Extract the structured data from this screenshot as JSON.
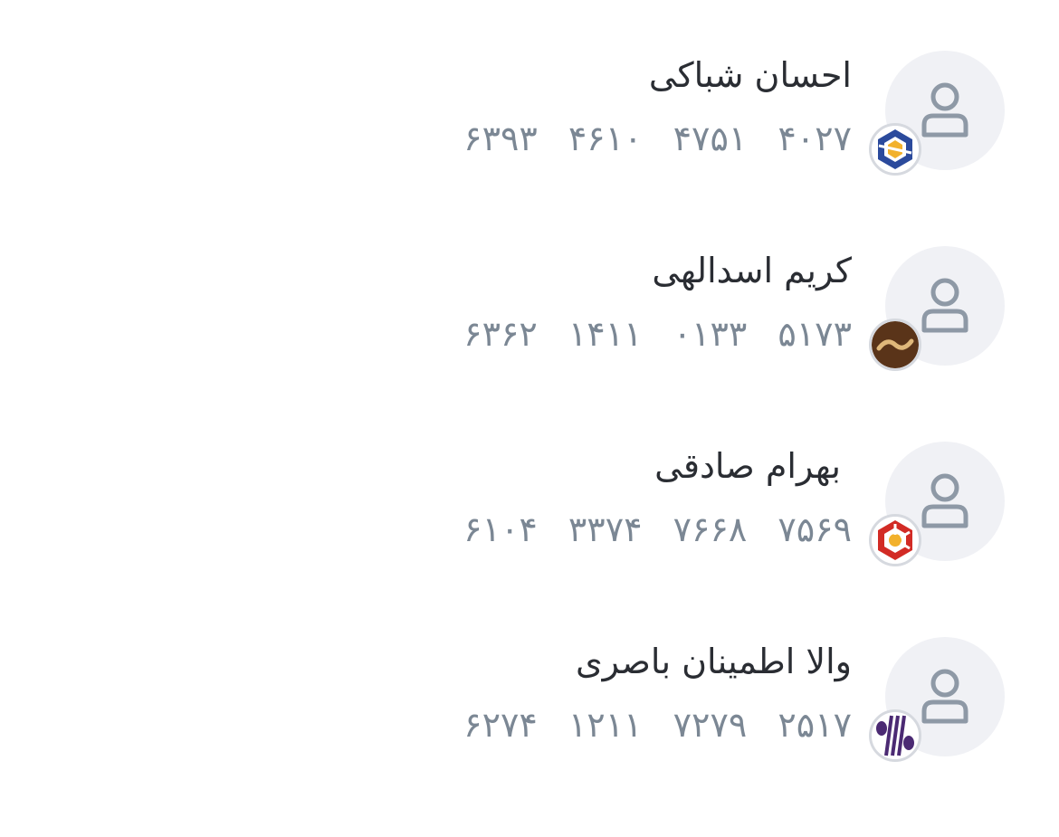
{
  "contacts": [
    {
      "name": "احسان شباکی",
      "card_groups": [
        "۶۳۹۳",
        "۴۶۱۰",
        "۴۷۵۱",
        "۴۰۲۷"
      ],
      "bank_icon": "sina-bank-logo-icon"
    },
    {
      "name": "کریم اسدالهی",
      "card_groups": [
        "۶۳۶۲",
        "۱۴۱۱",
        "۰۱۳۳",
        "۵۱۷۳"
      ],
      "bank_icon": "ansar-bank-logo-icon"
    },
    {
      "name": "بهرام   صادقی",
      "card_groups": [
        "۶۱۰۴",
        "۳۳۷۴",
        "۷۶۶۸",
        "۷۵۶۹"
      ],
      "bank_icon": "mellat-bank-logo-icon"
    },
    {
      "name": "والا اطمینان باصری",
      "card_groups": [
        "۶۲۷۴",
        "۱۲۱۱",
        "۷۲۷۹",
        "۲۵۱۷"
      ],
      "bank_icon": "eghtesad-novin-bank-logo-icon"
    }
  ],
  "colors": {
    "name_text": "#2a2d33",
    "card_text": "#7b8794",
    "avatar_bg": "#f0f1f5",
    "avatar_icon": "#8e99a6"
  }
}
